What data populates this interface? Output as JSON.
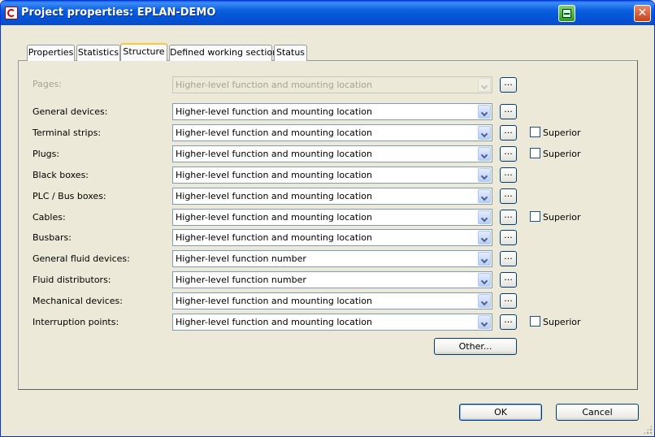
{
  "window": {
    "title": "Project properties: EPLAN-DEMO",
    "close_glyph": "✕"
  },
  "tabs": [
    {
      "label": "Properties"
    },
    {
      "label": "Statistics"
    },
    {
      "label": "Structure",
      "active": true
    },
    {
      "label": "Defined working sections"
    },
    {
      "label": "Status"
    }
  ],
  "rows": [
    {
      "label": "Pages:",
      "value": "Higher-level function and mounting location",
      "disabled": true
    },
    {
      "label": "General devices:",
      "value": "Higher-level function and mounting location"
    },
    {
      "label": "Terminal strips:",
      "value": "Higher-level function and mounting location",
      "superior": "Superior"
    },
    {
      "label": "Plugs:",
      "value": "Higher-level function and mounting location",
      "superior": "Superior"
    },
    {
      "label": "Black boxes:",
      "value": "Higher-level function and mounting location"
    },
    {
      "label": "PLC / Bus boxes:",
      "value": "Higher-level function and mounting location"
    },
    {
      "label": "Cables:",
      "value": "Higher-level function and mounting location",
      "superior": "Superior"
    },
    {
      "label": "Busbars:",
      "value": "Higher-level function and mounting location"
    },
    {
      "label": "General fluid devices:",
      "value": "Higher-level function number"
    },
    {
      "label": "Fluid distributors:",
      "value": "Higher-level function number"
    },
    {
      "label": "Mechanical devices:",
      "value": "Higher-level function and mounting location"
    },
    {
      "label": "Interruption points:",
      "value": "Higher-level function and mounting location",
      "superior": "Superior"
    }
  ],
  "dots_label": "...",
  "other_button": "Other...",
  "ok_button": "OK",
  "cancel_button": "Cancel",
  "colors": {
    "titlebar": "#0a5fe0",
    "dialog_bg": "#ece9d8",
    "active_tab_accent": "#ffc83c",
    "disabled_text": "#a7a293"
  }
}
